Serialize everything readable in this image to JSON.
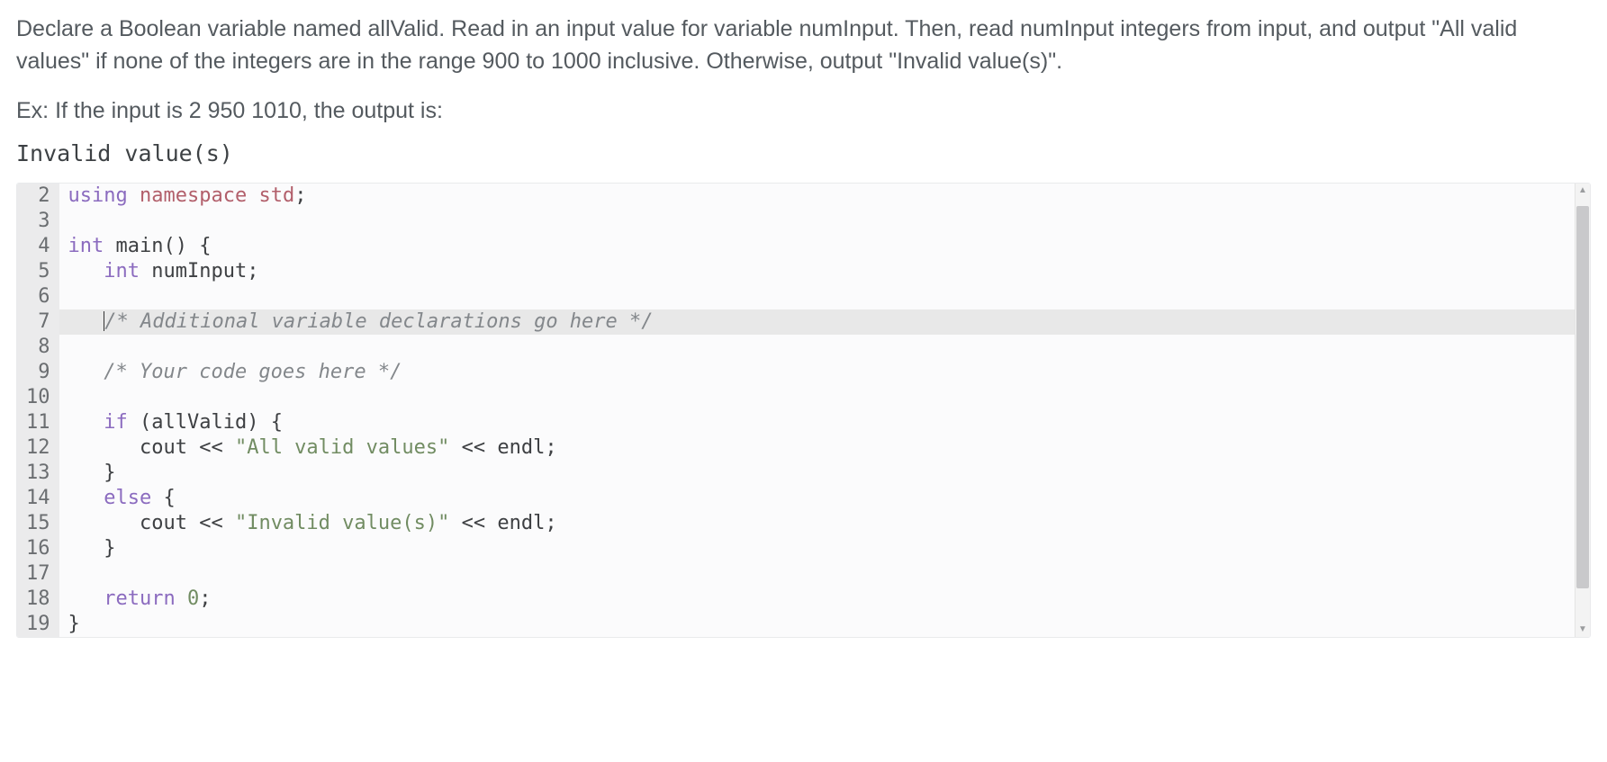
{
  "instructions": "Declare a Boolean variable named allValid. Read in an input value for variable numInput. Then, read numInput integers from input, and output \"All valid values\" if none of the integers are in the range 900 to 1000 inclusive. Otherwise, output \"Invalid value(s)\".",
  "example_label": "Ex: If the input is 2 950 1010, the output is:",
  "example_output": "Invalid value(s)",
  "editor": {
    "first_line_number": 2,
    "active_line_index": 5,
    "lines": [
      {
        "n": 2,
        "tokens": [
          [
            "kw",
            "using"
          ],
          [
            "punc",
            " "
          ],
          [
            "ns",
            "namespace"
          ],
          [
            "punc",
            " "
          ],
          [
            "ns",
            "std"
          ],
          [
            "punc",
            ";"
          ]
        ]
      },
      {
        "n": 3,
        "tokens": []
      },
      {
        "n": 4,
        "tokens": [
          [
            "kw",
            "int"
          ],
          [
            "punc",
            " "
          ],
          [
            "fn",
            "main"
          ],
          [
            "punc",
            "() {"
          ]
        ]
      },
      {
        "n": 5,
        "tokens": [
          [
            "punc",
            "   "
          ],
          [
            "kw",
            "int"
          ],
          [
            "punc",
            " "
          ],
          [
            "id",
            "numInput"
          ],
          [
            "punc",
            ";"
          ]
        ]
      },
      {
        "n": 6,
        "tokens": []
      },
      {
        "n": 7,
        "tokens": [
          [
            "punc",
            "   "
          ],
          [
            "caret",
            ""
          ],
          [
            "cmt",
            "/* Additional variable declarations go here */"
          ]
        ]
      },
      {
        "n": 8,
        "tokens": []
      },
      {
        "n": 9,
        "tokens": [
          [
            "punc",
            "   "
          ],
          [
            "cmt",
            "/* Your code goes here */"
          ]
        ]
      },
      {
        "n": 10,
        "tokens": []
      },
      {
        "n": 11,
        "tokens": [
          [
            "punc",
            "   "
          ],
          [
            "kw",
            "if"
          ],
          [
            "punc",
            " ("
          ],
          [
            "id",
            "allValid"
          ],
          [
            "punc",
            ") {"
          ]
        ]
      },
      {
        "n": 12,
        "tokens": [
          [
            "punc",
            "      "
          ],
          [
            "id",
            "cout"
          ],
          [
            "punc",
            " << "
          ],
          [
            "str",
            "\"All valid values\""
          ],
          [
            "punc",
            " << "
          ],
          [
            "id",
            "endl"
          ],
          [
            "punc",
            ";"
          ]
        ]
      },
      {
        "n": 13,
        "tokens": [
          [
            "punc",
            "   }"
          ]
        ]
      },
      {
        "n": 14,
        "tokens": [
          [
            "punc",
            "   "
          ],
          [
            "kw",
            "else"
          ],
          [
            "punc",
            " {"
          ]
        ]
      },
      {
        "n": 15,
        "tokens": [
          [
            "punc",
            "      "
          ],
          [
            "id",
            "cout"
          ],
          [
            "punc",
            " << "
          ],
          [
            "str",
            "\"Invalid value(s)\""
          ],
          [
            "punc",
            " << "
          ],
          [
            "id",
            "endl"
          ],
          [
            "punc",
            ";"
          ]
        ]
      },
      {
        "n": 16,
        "tokens": [
          [
            "punc",
            "   }"
          ]
        ]
      },
      {
        "n": 17,
        "tokens": []
      },
      {
        "n": 18,
        "tokens": [
          [
            "punc",
            "   "
          ],
          [
            "kw",
            "return"
          ],
          [
            "punc",
            " "
          ],
          [
            "num",
            "0"
          ],
          [
            "punc",
            ";"
          ]
        ]
      },
      {
        "n": 19,
        "tokens": [
          [
            "punc",
            "}"
          ]
        ]
      }
    ]
  },
  "scroll": {
    "up_glyph": "▲",
    "down_glyph": "▼"
  }
}
